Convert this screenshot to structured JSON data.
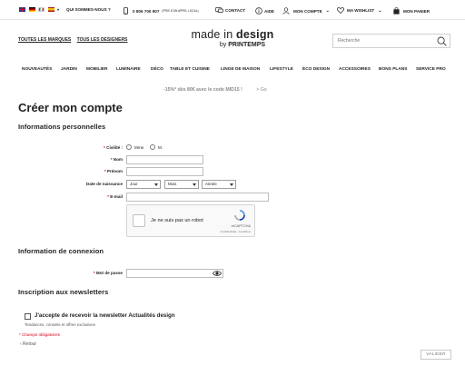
{
  "topbar": {
    "flags": [
      {
        "name": "uk-flag",
        "colors": [
          "#1f3a8a",
          "#c8102e"
        ]
      },
      {
        "name": "germany-flag",
        "colors": [
          "#000000",
          "#dd0000",
          "#ffce00"
        ]
      },
      {
        "name": "italy-flag",
        "colors": [
          "#009246",
          "#ffffff",
          "#ce2b37"
        ]
      },
      {
        "name": "spain-flag",
        "colors": [
          "#aa151b",
          "#f1bf00"
        ]
      }
    ],
    "about_label": "QUI SOMMES-NOUS ?",
    "phone_number": "0 806 700 907",
    "phone_note": "(PRIX D'UN APPEL LOCAL)",
    "contact_label": "CONTACT",
    "help_label": "AIDE",
    "account_label": "MON COMPTE",
    "wishlist_label": "MA WISHLIST",
    "cart_label": "MON PANIER"
  },
  "header": {
    "brands_link": "TOUTES LES MARQUES",
    "designers_link": "TOUS LES DESIGNERS",
    "logo_line1_a": "made in ",
    "logo_line1_b": "design",
    "logo_line2_a": "by ",
    "logo_line2_b": "PRINTEMPS",
    "search_placeholder": "Recherche"
  },
  "nav": {
    "items": [
      "NOUVEAUTÉS",
      "JARDIN",
      "MOBILIER",
      "LUMINAIRE",
      "DÉCO",
      "TABLE ET CUISINE",
      "LINGE DE MAISON",
      "LIFESTYLE",
      "ÉCO DESIGN",
      "ACCESSOIRES",
      "BONS PLANS",
      "SERVICE PRO"
    ]
  },
  "promo": {
    "text": "-15%* dès 80€ avec le code MID15 !",
    "separator": ">",
    "next": "Go"
  },
  "page": {
    "title": "Créer mon compte",
    "section_personal": "Informations personnelles",
    "civility_label": "Civilité :",
    "civility_options": [
      "Mme",
      "M."
    ],
    "lastname_label": "Nom",
    "firstname_label": "Prénom",
    "birthdate_label": "Date de naissance",
    "day_select": "Jour",
    "month_select": "Mois",
    "year_select": "Année",
    "email_label": "E-mail",
    "captcha_text": "Je ne suis pas un robot",
    "captcha_brand": "reCAPTCHA",
    "captcha_links": "Confidentialité - Conditions",
    "section_login": "Information de connexion",
    "password_label": "Mot de passe",
    "section_newsletter": "Inscription aux newsletters",
    "newsletter_checkbox_label": "J'accepte de recevoir la newsletter Actualités design",
    "newsletter_desc": "Tendances, conseils et offres exclusives",
    "required_note": "* Champs obligatoires",
    "back_link": "‹ Retour",
    "submit_label": "VALIDER",
    "required_star": "*"
  },
  "colors": {
    "required": "#d0021b",
    "promo_text": "#8a8a8a"
  }
}
